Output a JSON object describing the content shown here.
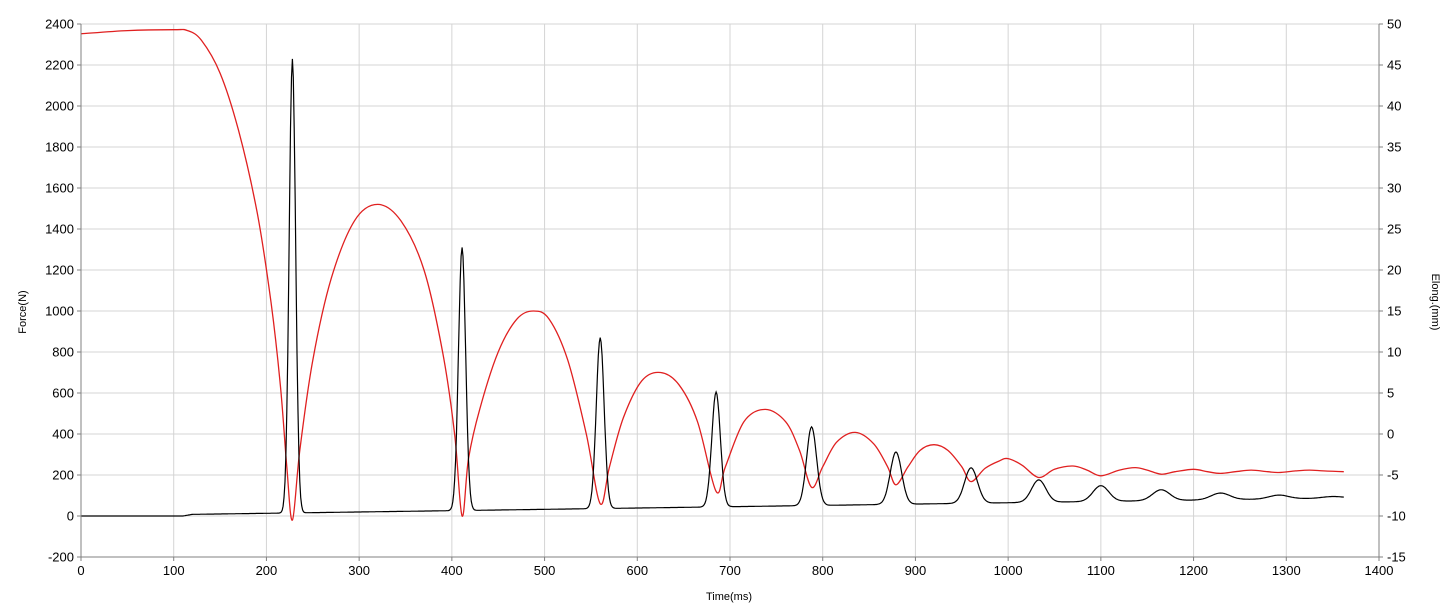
{
  "chart_data": {
    "type": "line",
    "title": "",
    "xlabel": "Time(ms)",
    "ylabel_left": "Force(N)",
    "ylabel_right": "Elong.(mm)",
    "xlim": [
      0,
      1400
    ],
    "ylim_left": [
      -200,
      2400
    ],
    "ylim_right": [
      -15,
      50
    ],
    "x_ticks": [
      "0",
      "100",
      "200",
      "300",
      "400",
      "500",
      "600",
      "700",
      "800",
      "900",
      "1000",
      "1100",
      "1200",
      "1300",
      "1400"
    ],
    "y_left_ticks": [
      "-200",
      "0",
      "200",
      "400",
      "600",
      "800",
      "1000",
      "1200",
      "1400",
      "1600",
      "1800",
      "2000",
      "2200",
      "2400"
    ],
    "y_right_ticks": [
      "-15",
      "-10",
      "-5",
      "0",
      "5",
      "10",
      "15",
      "20",
      "25",
      "30",
      "35",
      "40",
      "45",
      "50"
    ],
    "grid": true,
    "colors": {
      "force": "#000000",
      "elong": "#e02020",
      "grid": "#d4d4d4",
      "axis": "#808080"
    },
    "series": [
      {
        "axis": "left",
        "color": "#000000",
        "baseline_points": [
          [
            0,
            0
          ],
          [
            110,
            0
          ],
          [
            120,
            8
          ],
          [
            1362,
            88
          ]
        ],
        "peaks": [
          {
            "t": 228,
            "peak": 2230,
            "width": 9
          },
          {
            "t": 411,
            "peak": 1310,
            "width": 10
          },
          {
            "t": 560,
            "peak": 870,
            "width": 11
          },
          {
            "t": 685,
            "peak": 605,
            "width": 12
          },
          {
            "t": 788,
            "peak": 435,
            "width": 14
          },
          {
            "t": 879,
            "peak": 312,
            "width": 16
          },
          {
            "t": 960,
            "peak": 235,
            "width": 18
          },
          {
            "t": 1033,
            "peak": 176,
            "width": 20
          },
          {
            "t": 1100,
            "peak": 148,
            "width": 22
          },
          {
            "t": 1165,
            "peak": 128,
            "width": 24
          },
          {
            "t": 1229,
            "peak": 112,
            "width": 26
          },
          {
            "t": 1292,
            "peak": 102,
            "width": 27
          },
          {
            "t": 1350,
            "peak": 95,
            "width": 28
          }
        ]
      },
      {
        "axis": "right",
        "color": "#e02020",
        "points": [
          [
            0,
            48.8
          ],
          [
            50,
            49.2
          ],
          [
            100,
            49.3
          ],
          [
            115,
            49.2
          ],
          [
            130,
            48
          ],
          [
            150,
            44
          ],
          [
            170,
            37
          ],
          [
            190,
            27
          ],
          [
            205,
            16
          ],
          [
            215,
            6
          ],
          [
            222,
            -4
          ],
          [
            228,
            -10.5
          ],
          [
            236,
            -2
          ],
          [
            250,
            9
          ],
          [
            270,
            19
          ],
          [
            295,
            26
          ],
          [
            320,
            28
          ],
          [
            345,
            26
          ],
          [
            370,
            20
          ],
          [
            390,
            10
          ],
          [
            403,
            0
          ],
          [
            411,
            -10
          ],
          [
            418,
            -3
          ],
          [
            430,
            3
          ],
          [
            450,
            10
          ],
          [
            470,
            14
          ],
          [
            488,
            15
          ],
          [
            505,
            14
          ],
          [
            525,
            9
          ],
          [
            545,
            0
          ],
          [
            560,
            -8.5
          ],
          [
            570,
            -4
          ],
          [
            585,
            2
          ],
          [
            605,
            6.5
          ],
          [
            625,
            7.5
          ],
          [
            645,
            6
          ],
          [
            665,
            1.5
          ],
          [
            685,
            -7
          ],
          [
            695,
            -4
          ],
          [
            715,
            1.5
          ],
          [
            738,
            3
          ],
          [
            760,
            1.5
          ],
          [
            775,
            -2
          ],
          [
            788,
            -6.5
          ],
          [
            800,
            -4
          ],
          [
            815,
            -1
          ],
          [
            835,
            0.2
          ],
          [
            855,
            -1.2
          ],
          [
            870,
            -4
          ],
          [
            879,
            -6.2
          ],
          [
            892,
            -4
          ],
          [
            905,
            -2
          ],
          [
            920,
            -1.3
          ],
          [
            935,
            -2
          ],
          [
            950,
            -4
          ],
          [
            960,
            -5.8
          ],
          [
            975,
            -4.2
          ],
          [
            990,
            -3.3
          ],
          [
            1000,
            -3
          ],
          [
            1015,
            -3.8
          ],
          [
            1033,
            -5.3
          ],
          [
            1050,
            -4.3
          ],
          [
            1070,
            -3.9
          ],
          [
            1085,
            -4.4
          ],
          [
            1100,
            -5.1
          ],
          [
            1120,
            -4.4
          ],
          [
            1137,
            -4.1
          ],
          [
            1150,
            -4.4
          ],
          [
            1165,
            -4.9
          ],
          [
            1180,
            -4.6
          ],
          [
            1200,
            -4.3
          ],
          [
            1215,
            -4.6
          ],
          [
            1229,
            -4.8
          ],
          [
            1245,
            -4.6
          ],
          [
            1262,
            -4.4
          ],
          [
            1280,
            -4.6
          ],
          [
            1292,
            -4.7
          ],
          [
            1310,
            -4.5
          ],
          [
            1325,
            -4.4
          ],
          [
            1340,
            -4.5
          ],
          [
            1362,
            -4.6
          ]
        ]
      }
    ]
  }
}
